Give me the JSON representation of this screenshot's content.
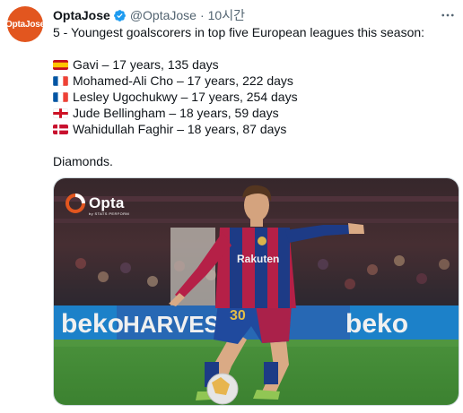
{
  "author": {
    "avatar_text": "OptaJose",
    "display_name": "OptaJose",
    "handle": "@OptaJose",
    "separator": "·",
    "time": "10시간",
    "verified": true,
    "more_icon": "more-icon"
  },
  "tweet": {
    "headline": "5 - Youngest goalscorers in top five European leagues this season:",
    "players": [
      {
        "flag": "spain",
        "text": "Gavi – 17 years, 135 days"
      },
      {
        "flag": "france",
        "text": "Mohamed-Ali Cho – 17 years, 222 days"
      },
      {
        "flag": "france",
        "text": "Lesley Ugochukwy – 17 years, 254 days"
      },
      {
        "flag": "england",
        "text": "Jude Bellingham – 18 years, 59 days"
      },
      {
        "flag": "denmark",
        "text": "Wahidullah Faghir – 18 years, 87 days"
      }
    ],
    "closing": "Diamonds."
  },
  "media": {
    "badge_title": "Opta",
    "badge_subtitle": "by STATS PERFORM",
    "shirt_sponsor": "Rakuten",
    "shirt_number": "30",
    "boards": [
      "beko",
      "HARVES",
      "beko"
    ]
  },
  "colors": {
    "brand": "#e2561f",
    "verified": "#1d9bf0",
    "secondary_text": "#536471"
  }
}
